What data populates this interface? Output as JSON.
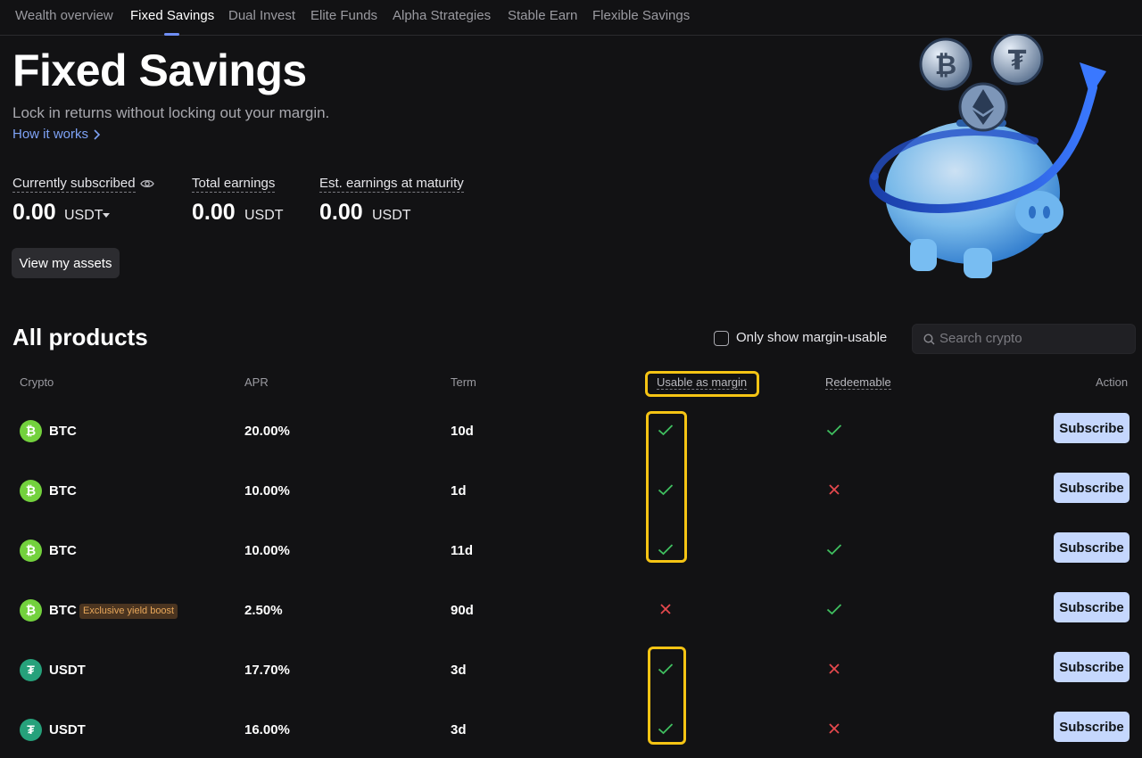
{
  "nav": {
    "tabs": [
      "Wealth overview",
      "Fixed Savings",
      "Dual Invest",
      "Elite Funds",
      "Alpha Strategies",
      "Stable Earn",
      "Flexible Savings"
    ],
    "active": "Fixed Savings"
  },
  "header": {
    "title": "Fixed Savings",
    "subtitle": "Lock in returns without locking out your margin.",
    "how_link": "How it works"
  },
  "stats": {
    "subscribed": {
      "label": "Currently subscribed",
      "value": "0.00",
      "unit": "USDT"
    },
    "total": {
      "label": "Total earnings",
      "value": "0.00",
      "unit": "USDT"
    },
    "maturity": {
      "label": "Est. earnings at maturity",
      "value": "0.00",
      "unit": "USDT"
    }
  },
  "view_assets": "View my assets",
  "products": {
    "title": "All products",
    "filter_label": "Only show margin-usable",
    "search_placeholder": "Search crypto",
    "columns": {
      "crypto": "Crypto",
      "apr": "APR",
      "term": "Term",
      "margin": "Usable as margin",
      "redeemable": "Redeemable",
      "action": "Action"
    },
    "rows": [
      {
        "coin": "BTC",
        "icon": "btc-icon",
        "badge": "",
        "apr": "20.00%",
        "term": "10d",
        "margin": true,
        "redeemable": true,
        "action": "Subscribe"
      },
      {
        "coin": "BTC",
        "icon": "btc-icon",
        "badge": "",
        "apr": "10.00%",
        "term": "1d",
        "margin": true,
        "redeemable": false,
        "action": "Subscribe"
      },
      {
        "coin": "BTC",
        "icon": "btc-icon",
        "badge": "",
        "apr": "10.00%",
        "term": "11d",
        "margin": true,
        "redeemable": true,
        "action": "Subscribe"
      },
      {
        "coin": "BTC",
        "icon": "btc-icon",
        "badge": "Exclusive yield boost",
        "apr": "2.50%",
        "term": "90d",
        "margin": false,
        "redeemable": true,
        "action": "Subscribe"
      },
      {
        "coin": "USDT",
        "icon": "usdt-icon",
        "badge": "",
        "apr": "17.70%",
        "term": "3d",
        "margin": true,
        "redeemable": false,
        "action": "Subscribe"
      },
      {
        "coin": "USDT",
        "icon": "usdt-icon",
        "badge": "",
        "apr": "16.00%",
        "term": "3d",
        "margin": true,
        "redeemable": false,
        "action": "Subscribe"
      }
    ]
  },
  "colors": {
    "accent": "#6f8ef5",
    "check": "#3fbf5f",
    "cross": "#e5484d",
    "highlight": "#f5c414",
    "subscribe": "#c5d7fd",
    "btc": "#73d13d",
    "usdt": "#26a17b"
  }
}
